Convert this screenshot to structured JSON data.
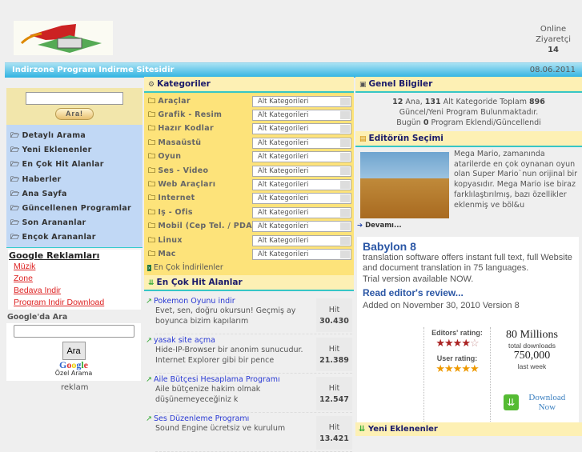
{
  "header": {
    "online_label": "Online",
    "visitors_label": "Ziyaretçi",
    "visitor_count": "14",
    "site_title": "Indirzone Program Indirme Sitesidir",
    "date": "08.06.2011"
  },
  "sidebar": {
    "search_button": "Ara!",
    "menu": [
      "Detaylı Arama",
      "Yeni Eklenenler",
      "En Çok Hit Alanlar",
      "Haberler",
      "Ana Sayfa",
      "Güncellenen Programlar",
      "Son Arananlar",
      "Ençok Arananlar"
    ],
    "ads_title": "Google Reklamları",
    "ads": [
      "Müzik",
      "Zone",
      "Bedava Indir",
      "Program Indir Download"
    ],
    "google_search_label": "Google'da Ara",
    "google_search_button": "Ara",
    "google_logo": "Google",
    "google_sub": "Özel Arama",
    "reklam": "reklam"
  },
  "categories": {
    "title": "Kategoriler",
    "select_label": "Alt Kategorileri",
    "items": [
      "Araçlar",
      "Grafik - Resim",
      "Hazır Kodlar",
      "Masaüstü",
      "Oyun",
      "Ses - Video",
      "Web Araçları",
      "Internet",
      "Iş - Ofis",
      "Mobil (Cep Tel. / PDA)",
      "Linux",
      "Mac"
    ],
    "most_downloaded": "En Çok İndirilenler"
  },
  "top_hits": {
    "title": "En Çok Hit Alanlar",
    "hit_label": "Hit",
    "items": [
      {
        "title": "Pokemon Oyunu indir",
        "desc": "Evet, sen, doğru okursun! Geçmiş ay boyunca bizim kapılarım",
        "hits": "30.430"
      },
      {
        "title": "yasak site açma",
        "desc": "Hide-IP-Browser bir anonim sunucudur. Internet Explorer gibi bir pence",
        "hits": "21.389"
      },
      {
        "title": "Aile Bütçesi Hesaplama Programı",
        "desc": "Aile bütçenize hakim olmak düşünemeyeceğiniz k",
        "hits": "12.547"
      },
      {
        "title": "Ses Düzenleme Programı",
        "desc": "Sound Engine ücretsiz ve kurulum",
        "hits": "13.421"
      }
    ]
  },
  "general": {
    "title": "Genel Bilgiler",
    "main_count": "12",
    "main_label": "Ana,",
    "sub_count": "131",
    "sub_label": "Alt Kategoride Toplam",
    "total": "896",
    "line2": "Güncel/Yeni Program Bulunmaktadır.",
    "today_prefix": "Bugün",
    "today_count": "0",
    "today_suffix": "Program Eklendi/Güncellendi"
  },
  "editor": {
    "title": "Editörün Seçimi",
    "text": "Mega Mario, zamanında atarilerde en çok oynanan oyun olan Super Mario`nun orijinal bir kopyasıdır. Mega Mario ise biraz farklılaştırılmış, bazı özellikler eklenmiş ve böl&u",
    "more": "Devamı..."
  },
  "ad": {
    "title": "Babylon 8",
    "desc": "translation software offers instant full text, full Website and document translation in 75 languages.",
    "trial": "Trial version available NOW.",
    "review": "Read editor's review...",
    "added": "Added on November 30, 2010 Version 8",
    "editors_rating_label": "Editors' rating:",
    "editors_rating": 4,
    "user_rating_label": "User rating:",
    "user_rating": 5,
    "total": "80 Millions",
    "total_label": "total downloads",
    "week": "750,000",
    "week_label": "last week",
    "download": "Download Now"
  },
  "new_added": {
    "title": "Yeni Eklenenler"
  }
}
